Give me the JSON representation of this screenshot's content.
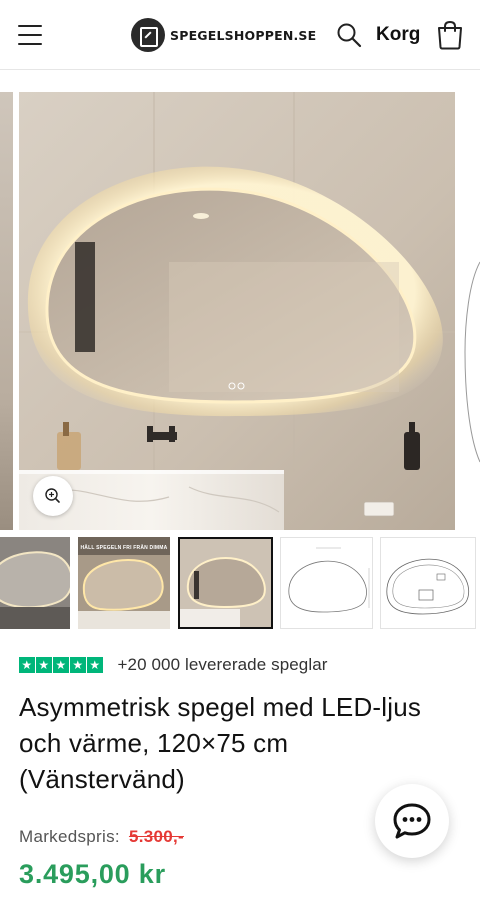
{
  "header": {
    "logo_text": "SPEGELSHOPPEN.SE",
    "cart_label": "Korg",
    "icons": [
      "menu-icon",
      "search-icon",
      "shopping-bag-icon"
    ]
  },
  "gallery": {
    "slides_visible": 3,
    "zoom_icon": "zoom-in-icon",
    "thumbnails": [
      {
        "name": "thumb-1",
        "active": false
      },
      {
        "name": "thumb-2",
        "banner": "HÅLL SPEGELN FRI FRÅN DIMMA",
        "active": false
      },
      {
        "name": "thumb-3",
        "active": true
      },
      {
        "name": "thumb-4",
        "active": false
      },
      {
        "name": "thumb-5",
        "active": false
      }
    ]
  },
  "product": {
    "rating_stars": 5,
    "rating_text": "+20 000 levererade speglar",
    "title": "Asymmetrisk spegel med LED-ljus och värme, 120×75 cm (Vänstervänd)",
    "market_price_label": "Markedspris:",
    "market_price": "5.300,-",
    "price": "3.495,00 kr"
  },
  "colors": {
    "trustpilot_green": "#00b67a",
    "price_green": "#2a9d5c",
    "old_price_red": "#e53935",
    "text": "#121212"
  },
  "chat": {
    "icon": "chat-bubble-icon"
  }
}
